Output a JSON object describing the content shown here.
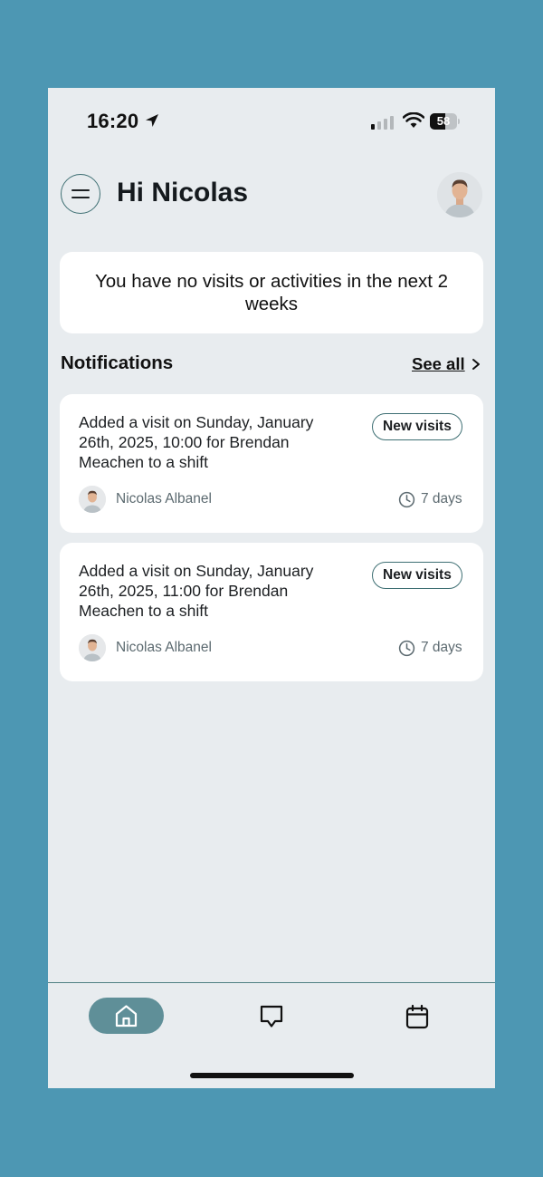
{
  "status_bar": {
    "time": "16:20",
    "battery_level": "58",
    "battery_fraction": 0.58,
    "icons": [
      "location-arrow-icon",
      "cellular-signal-icon",
      "wifi-icon",
      "battery-icon"
    ]
  },
  "header": {
    "greeting": "Hi Nicolas",
    "menu_icon": "hamburger-menu-icon",
    "avatar": "user-avatar"
  },
  "empty_state": {
    "message": "You have no visits or activities in the next 2 weeks"
  },
  "notifications": {
    "title": "Notifications",
    "see_all_label": "See all",
    "items": [
      {
        "text": "Added a visit on Sunday, January 26th, 2025, 10:00 for Brendan Meachen to a shift",
        "badge": "New visits",
        "author": "Nicolas Albanel",
        "age": "7 days"
      },
      {
        "text": "Added a visit on Sunday, January 26th, 2025, 11:00 for Brendan Meachen to a shift",
        "badge": "New visits",
        "author": "Nicolas Albanel",
        "age": "7 days"
      }
    ]
  },
  "bottom_nav": {
    "items": [
      {
        "icon": "home-icon",
        "active": true
      },
      {
        "icon": "chat-bubble-icon",
        "active": false
      },
      {
        "icon": "calendar-icon",
        "active": false
      }
    ]
  },
  "colors": {
    "page_background": "#4d97b3",
    "screen_background": "#e8ecef",
    "card_background": "#ffffff",
    "accent_teal": "#3e6f73",
    "active_nav": "#5f8f98"
  }
}
